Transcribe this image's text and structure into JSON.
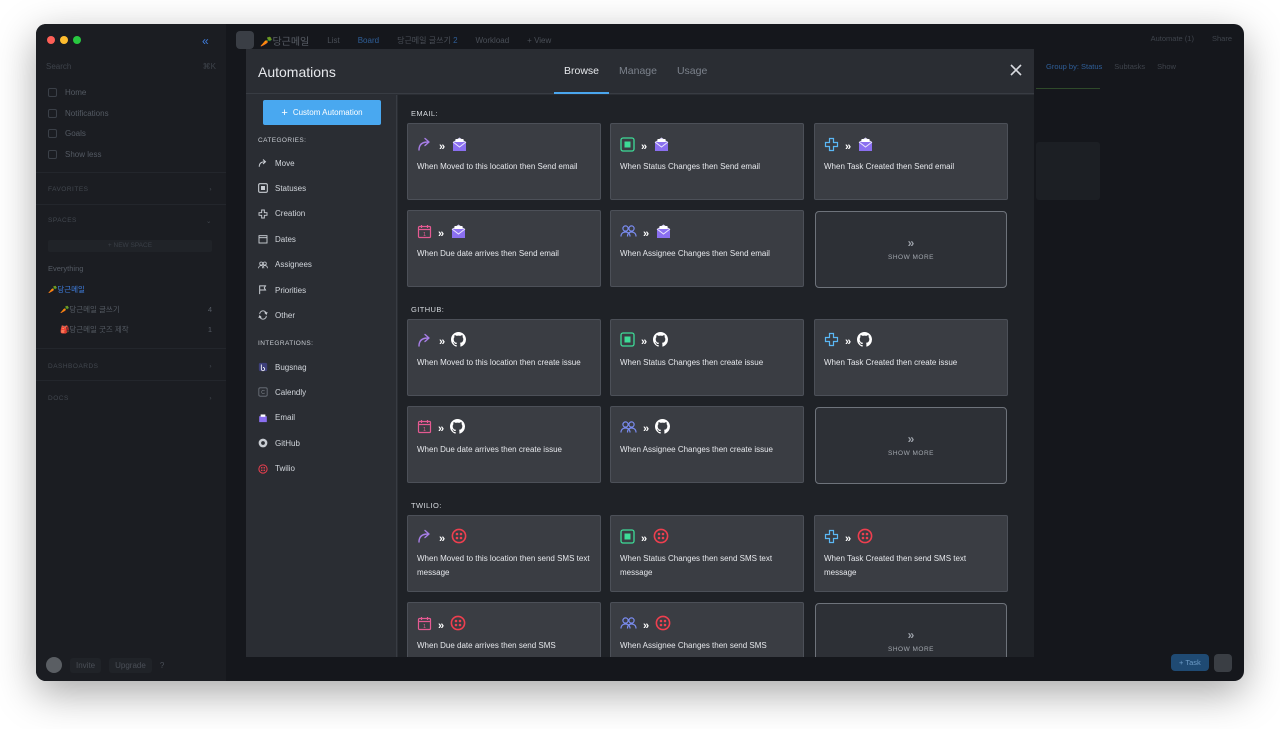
{
  "sidebar": {
    "search_placeholder": "Search",
    "search_shortcut": "⌘K",
    "nav": [
      {
        "label": "Home",
        "icon": "home-icon"
      },
      {
        "label": "Notifications",
        "icon": "bell-icon"
      },
      {
        "label": "Goals",
        "icon": "trophy-icon"
      },
      {
        "label": "Show less",
        "icon": "arrow-up-icon"
      }
    ],
    "favorites_label": "FAVORITES",
    "spaces_label": "SPACES",
    "new_space_label": "+ NEW SPACE",
    "spaces": [
      {
        "label": "Everything",
        "count": ""
      },
      {
        "label": "🥕당근메일",
        "count": ""
      },
      {
        "label": "🥕당근메일 글쓰기",
        "count": "4"
      },
      {
        "label": "🎒당근메일 굿즈 제작",
        "count": "1"
      }
    ],
    "dashboards_label": "DASHBOARDS",
    "docs_label": "DOCS",
    "invite_label": "Invite",
    "upgrade_label": "Upgrade"
  },
  "topbar": {
    "project": "🥕당근메일",
    "views": [
      "List",
      "Board",
      "당근메일 글쓰기",
      "Workload",
      "+ View"
    ],
    "board_count": "2",
    "automate": "Automate (1)",
    "share": "Share"
  },
  "subbar": {
    "group_by": "Group by: Status",
    "subtasks": "Subtasks",
    "show": "Show"
  },
  "fab_label": "+ Task",
  "modal": {
    "title": "Automations",
    "tabs": [
      "Browse",
      "Manage",
      "Usage"
    ],
    "active_tab": "Browse",
    "custom_button": "Custom Automation",
    "categories_label": "CATEGORIES:",
    "categories": [
      {
        "label": "Move",
        "icon": "move-arrow-icon"
      },
      {
        "label": "Statuses",
        "icon": "status-square-icon"
      },
      {
        "label": "Creation",
        "icon": "plus-icon"
      },
      {
        "label": "Dates",
        "icon": "calendar-icon"
      },
      {
        "label": "Assignees",
        "icon": "people-icon"
      },
      {
        "label": "Priorities",
        "icon": "flag-icon"
      },
      {
        "label": "Other",
        "icon": "cycle-icon"
      }
    ],
    "integrations_label": "INTEGRATIONS:",
    "integrations": [
      {
        "label": "Bugsnag",
        "icon": "bugsnag-icon"
      },
      {
        "label": "Calendly",
        "icon": "calendly-icon"
      },
      {
        "label": "Email",
        "icon": "email-icon"
      },
      {
        "label": "GitHub",
        "icon": "github-icon"
      },
      {
        "label": "Twilio",
        "icon": "twilio-icon"
      }
    ],
    "show_more_label": "SHOW MORE",
    "groups": [
      {
        "label": "EMAIL:",
        "action": "email",
        "cards": [
          {
            "trigger": "move",
            "prefix": "When Moved to this location then ",
            "bold": "Send email"
          },
          {
            "trigger": "status",
            "prefix": "When Status Changes then ",
            "bold": "Send email"
          },
          {
            "trigger": "create",
            "prefix": "When Task Created then ",
            "bold": "Send email"
          },
          {
            "trigger": "date",
            "prefix": "When Due date arrives then ",
            "bold": "Send email"
          },
          {
            "trigger": "assignee",
            "prefix": "When Assignee Changes then ",
            "bold": "Send email"
          }
        ]
      },
      {
        "label": "GITHUB:",
        "action": "github",
        "cards": [
          {
            "trigger": "move",
            "prefix": "When Moved to this location then ",
            "bold": "create issue"
          },
          {
            "trigger": "status",
            "prefix": "When Status Changes then ",
            "bold": "create issue"
          },
          {
            "trigger": "create",
            "prefix": "When Task Created then ",
            "bold": "create issue"
          },
          {
            "trigger": "date",
            "prefix": "When Due date arrives then ",
            "bold": "create issue"
          },
          {
            "trigger": "assignee",
            "prefix": "When Assignee Changes then ",
            "bold": "create issue"
          }
        ]
      },
      {
        "label": "TWILIO:",
        "action": "twilio",
        "cards": [
          {
            "trigger": "move",
            "prefix": "When Moved to this location then ",
            "bold": "send SMS text message"
          },
          {
            "trigger": "status",
            "prefix": "When Status Changes then ",
            "bold": "send SMS text message"
          },
          {
            "trigger": "create",
            "prefix": "When Task Created then ",
            "bold": "send SMS text message"
          },
          {
            "trigger": "date",
            "prefix": "When Due date arrives then ",
            "bold": "send SMS"
          },
          {
            "trigger": "assignee",
            "prefix": "When Assignee Changes then ",
            "bold": "send SMS"
          }
        ]
      }
    ]
  },
  "colors": {
    "accent": "#49a8f0",
    "move": "#a77ee6",
    "status": "#3ddc97",
    "create": "#5bb8f5",
    "date": "#e45a92",
    "assignee": "#7a8cf0",
    "email": "#8a6ff0",
    "twilio": "#ef3f4f"
  }
}
